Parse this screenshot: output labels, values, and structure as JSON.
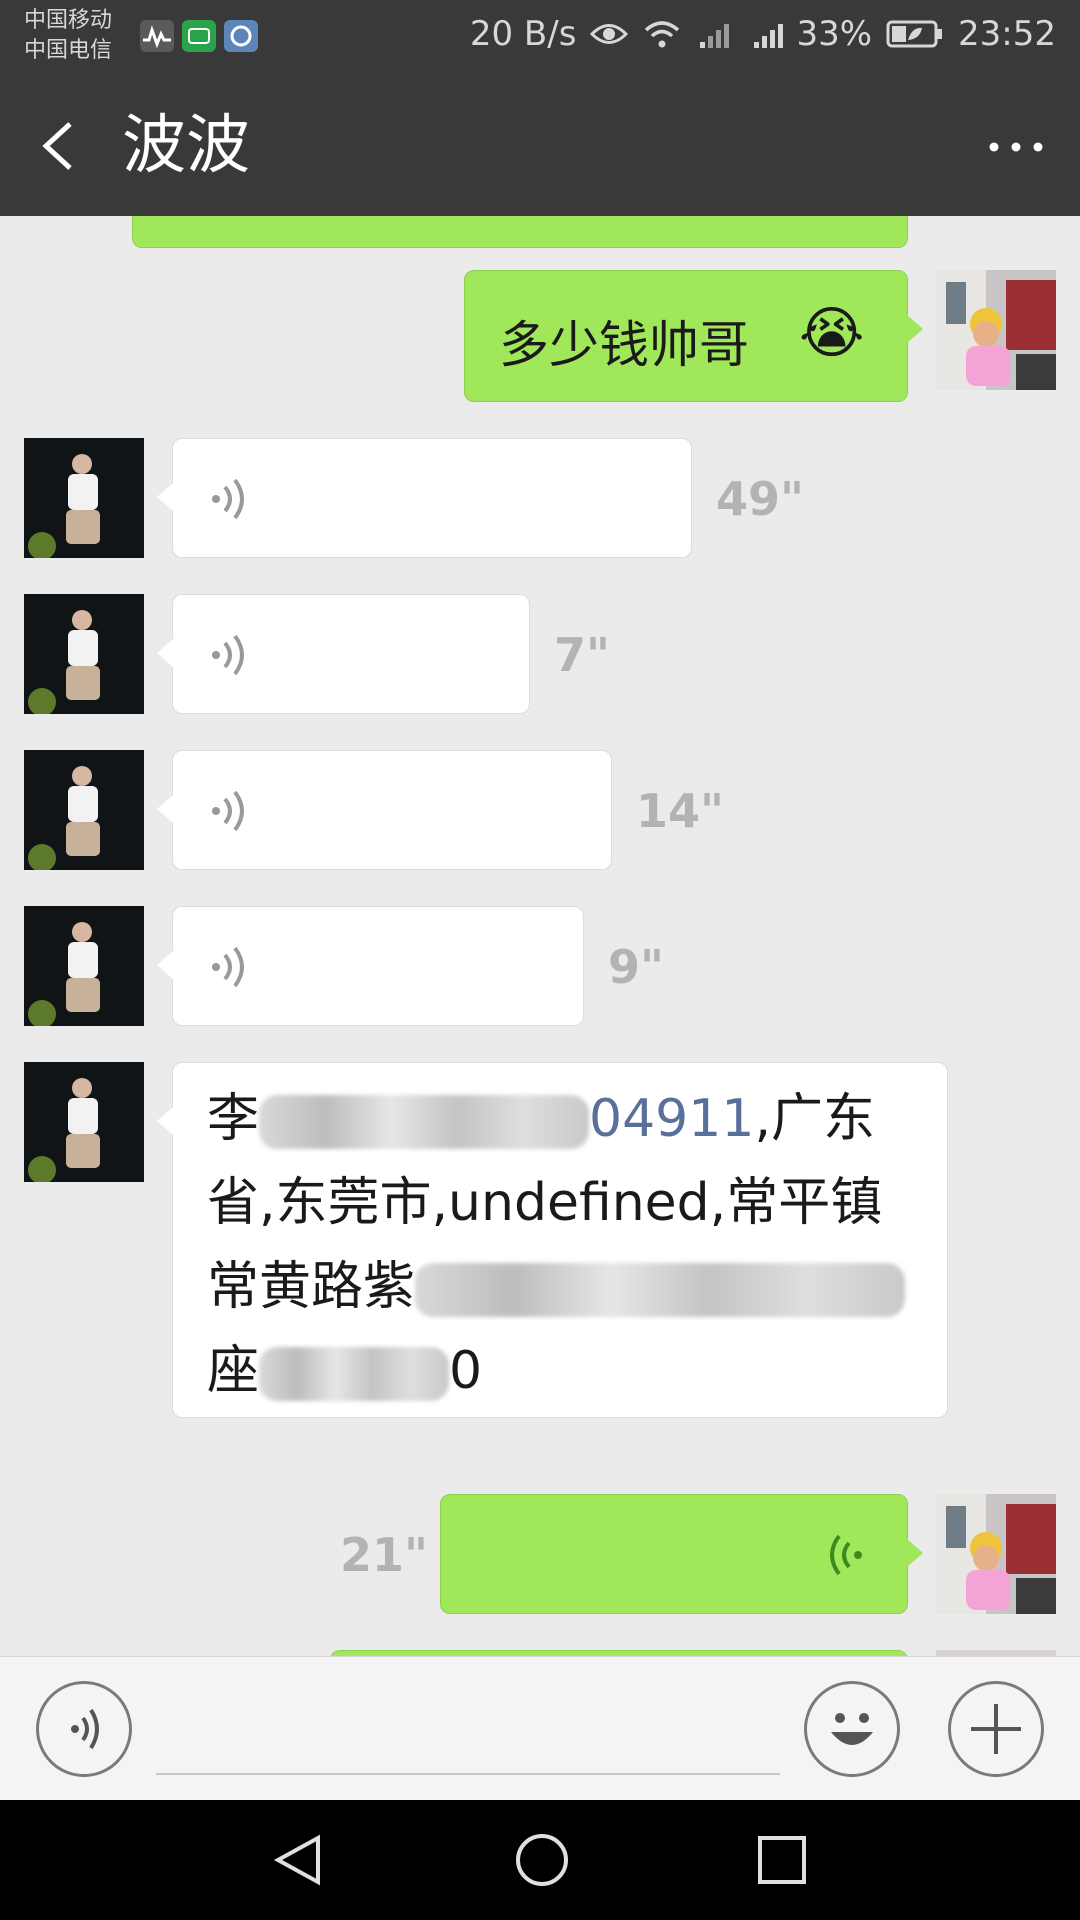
{
  "status_bar": {
    "carrier_1": "中国移动",
    "carrier_2": "中国电信",
    "network_speed": "20 B/s",
    "battery": "33%",
    "time": "23:52"
  },
  "header": {
    "title": "波波",
    "back_icon": "chevron-left-icon",
    "more_icon": "more-dots-icon"
  },
  "messages": [
    {
      "side": "right",
      "type": "text",
      "text": "多少钱帅哥",
      "emoji": "😭"
    },
    {
      "side": "left",
      "type": "voice",
      "duration": "49\""
    },
    {
      "side": "left",
      "type": "voice",
      "duration": "7\""
    },
    {
      "side": "left",
      "type": "voice",
      "duration": "14\""
    },
    {
      "side": "left",
      "type": "voice",
      "duration": "9\""
    },
    {
      "side": "left",
      "type": "text",
      "line1_start": "李",
      "line1_visible": "04911",
      "line1_end": ",广东",
      "line2": "省,东莞市,undefined,常平镇",
      "line3_start": "常黄路紫",
      "line4_start": "座",
      "line4_end": "0"
    },
    {
      "side": "right",
      "type": "voice",
      "duration": "21\""
    }
  ],
  "colors": {
    "header_bg": "#393939",
    "chat_bg": "#ebebeb",
    "bubble_green": "#a0e75a",
    "bubble_white": "#ffffff",
    "duration_gray": "#b3b3b3",
    "link_blue": "#5a6f9a"
  },
  "input_bar": {
    "voice_icon": "voice-toggle-icon",
    "emoji_icon": "emoji-icon",
    "plus_icon": "plus-icon"
  },
  "system_nav": {
    "back_icon": "nav-back-icon",
    "home_icon": "nav-home-icon",
    "recents_icon": "nav-recents-icon"
  }
}
